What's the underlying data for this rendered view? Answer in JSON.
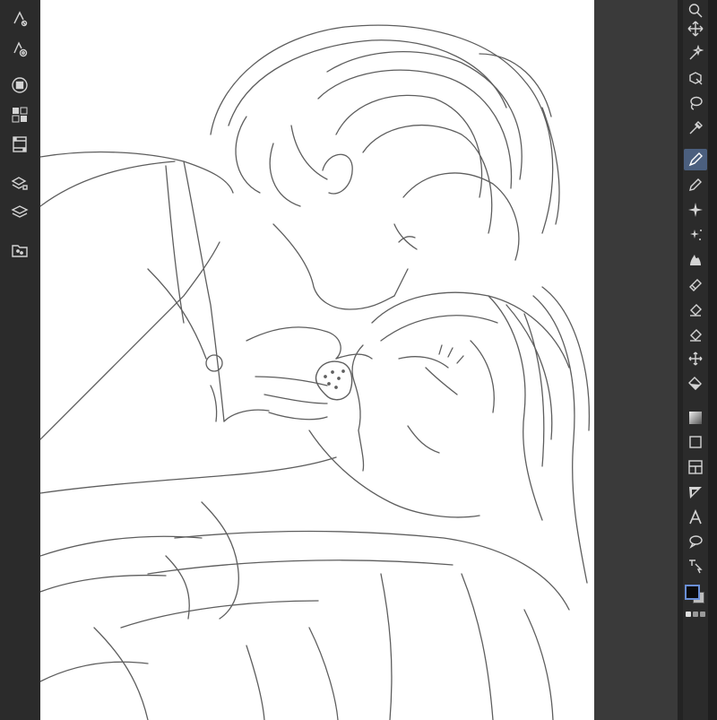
{
  "app": {
    "colors": {
      "toolbar_bg": "#2b2b2b",
      "workspace_bg": "#3a3a3a",
      "canvas_bg": "#ffffff",
      "icon": "#d4d4d4",
      "active_tool": "#4b5f7e",
      "foreground_color": "#0b0b0b",
      "background_color": "#bdbdbd"
    }
  },
  "left_toolbar": {
    "buttons": [
      {
        "name": "brush-settings-icon"
      },
      {
        "name": "brush-target-icon"
      },
      {
        "name": "color-wheel-icon"
      },
      {
        "name": "color-set-icon"
      },
      {
        "name": "animation-timeline-icon"
      },
      {
        "name": "layer-property-icon"
      },
      {
        "name": "layers-icon"
      },
      {
        "name": "material-library-icon"
      }
    ]
  },
  "right_toolbar": {
    "tools": [
      {
        "name": "zoom-icon"
      },
      {
        "name": "move-icon"
      },
      {
        "name": "magic-wand-icon"
      },
      {
        "name": "object-select-icon"
      },
      {
        "name": "lasso-icon"
      },
      {
        "name": "eyedropper-icon"
      },
      {
        "name": "pen-icon",
        "active": true
      },
      {
        "name": "pencil-icon"
      },
      {
        "name": "brush-sparkle-icon"
      },
      {
        "name": "airbrush-icon"
      },
      {
        "name": "blend-icon"
      },
      {
        "name": "eraser-icon"
      },
      {
        "name": "eraser-hard-icon"
      },
      {
        "name": "eraser-soft-icon"
      },
      {
        "name": "transform-move-icon"
      },
      {
        "name": "fill-bucket-icon"
      },
      {
        "name": "gradient-icon"
      },
      {
        "name": "rectangle-icon"
      },
      {
        "name": "frame-icon"
      },
      {
        "name": "ruler-icon"
      },
      {
        "name": "text-icon"
      },
      {
        "name": "speech-bubble-icon"
      },
      {
        "name": "correct-line-icon"
      }
    ]
  }
}
